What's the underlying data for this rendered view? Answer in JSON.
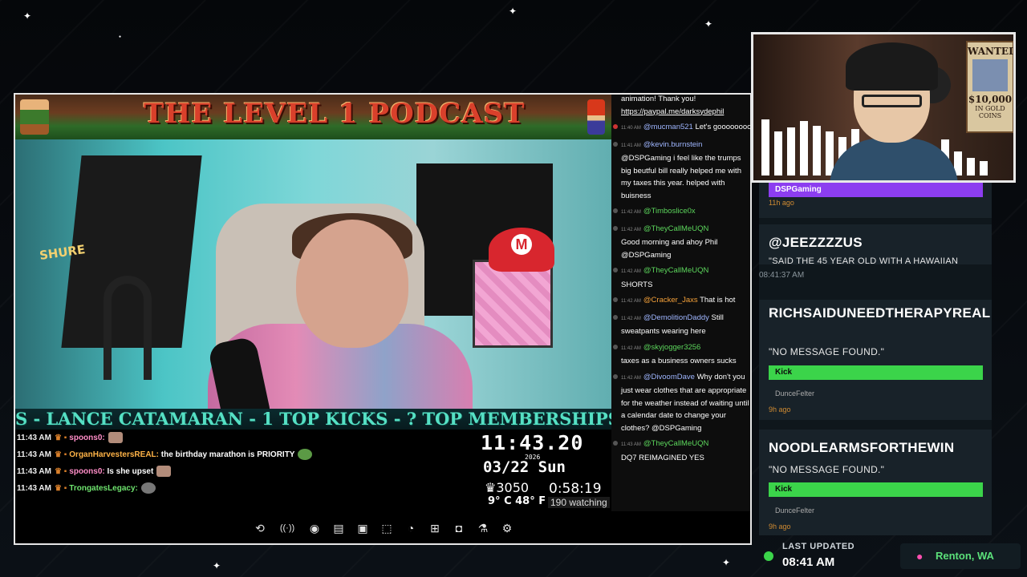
{
  "overlay": {
    "banner_title": "THE LEVEL 1 PODCAST",
    "ticker_text": "S - LANCE CATAMARAN - 1     TOP KICKS - ?     TOP MEMBERSHIPS - ",
    "clock": {
      "time": "11:43.20",
      "year": "2026",
      "date": "03/22 Sun",
      "subs": "3050",
      "uptime": "0:58:19",
      "temp": "9° C 48° F",
      "watching": "190 watching"
    },
    "chat": [
      {
        "time": "11:43 AM",
        "name": "spoons0:",
        "name_color": "pink",
        "text": ""
      },
      {
        "time": "11:43 AM",
        "name": "OrganHarvestersREAL:",
        "name_color": "orange",
        "text": "the birthday marathon is PRIORITY"
      },
      {
        "time": "11:43 AM",
        "name": "spoons0:",
        "name_color": "pink",
        "text": "Is she upset"
      },
      {
        "time": "11:43 AM",
        "name": "TrongatesLegacy:",
        "name_color": "green",
        "text": ""
      }
    ]
  },
  "stream_chat": [
    {
      "user": "",
      "user_color": "blue",
      "text": "animation! Thank you!",
      "link": "https://paypal.me/darksydephil"
    },
    {
      "meta": "11:40 AM",
      "user": "@mucman521",
      "user_color": "blue",
      "text": "Let's goooooooo"
    },
    {
      "meta": "11:41 AM",
      "user": "@kevin.burnstein",
      "user_color": "blue",
      "text": "@DSPGaming i feel like the trumps big beutful bill really helped me with my taxes this year. helped with buisness"
    },
    {
      "meta": "11:42 AM",
      "user": "@Timboslice0x",
      "user_color": "green",
      "text": ""
    },
    {
      "meta": "11:42 AM",
      "user": "@TheyCallMeUQN",
      "user_color": "green",
      "text": "Good morning and ahoy Phil @DSPGaming"
    },
    {
      "meta": "11:42 AM",
      "user": "@TheyCallMeUQN",
      "user_color": "green",
      "text": "SHORTS"
    },
    {
      "meta": "11:42 AM",
      "user": "@Cracker_Jaxs",
      "user_color": "green",
      "text": "That is hot"
    },
    {
      "meta": "11:42 AM",
      "user": "@DemolitionDaddy",
      "user_color": "blue",
      "text": "Still sweatpants wearing here"
    },
    {
      "meta": "11:42 AM",
      "user": "@skyjogger3256",
      "user_color": "green",
      "text": "taxes as a business owners sucks"
    },
    {
      "meta": "11:42 AM",
      "user": "@DivoomDave",
      "user_color": "blue",
      "text": "Why don't you just wear clothes that are appropriate for the weather instead of waiting until a calendar date to change your clothes? @DSPGaming"
    },
    {
      "meta": "11:43 AM",
      "user": "@TheyCallMeUQN",
      "user_color": "green",
      "text": "DQ7 REIMAGINED YES"
    }
  ],
  "controls": [
    {
      "name": "loop-icon",
      "glyph": "⟲"
    },
    {
      "name": "broadcast-icon",
      "glyph": "((·))"
    },
    {
      "name": "view-icon",
      "glyph": "◉"
    },
    {
      "name": "clapper-icon",
      "glyph": "▤"
    },
    {
      "name": "pip-icon",
      "glyph": "▣"
    },
    {
      "name": "crop-icon",
      "glyph": "⬚"
    },
    {
      "name": "speed-icon",
      "glyph": "◔"
    },
    {
      "name": "add-frame-icon",
      "glyph": "⊞"
    },
    {
      "name": "camera-icon",
      "glyph": "◘"
    },
    {
      "name": "flask-icon",
      "glyph": "⚗"
    },
    {
      "name": "gear-icon",
      "glyph": "⚙"
    }
  ],
  "alerts": {
    "top_label": "DSPGaming",
    "top_ago": "11h ago",
    "card1": {
      "title": "@JEEZZZZUS",
      "msg": "\"SAID THE 45 YEAR OLD WITH A HAWAIIAN",
      "timestamp": "08:41:37 AM"
    },
    "card2": {
      "title": "RICHSAIDUNEEDTHERAPYREAL",
      "msg": "\"NO MESSAGE FOUND.\"",
      "label": "Kick",
      "user": "DunceFelter",
      "ago": "9h ago"
    },
    "card3": {
      "title": "NOODLEARMSFORTHEWIN",
      "msg": "\"NO MESSAGE FOUND.\"",
      "label": "Kick",
      "user": "DunceFelter",
      "ago": "9h ago"
    },
    "colors": {
      "kick": "#3bd44a",
      "purple": "#8c3df0"
    }
  },
  "footer": {
    "last_updated_label": "LAST UPDATED",
    "last_updated_time": "08:41 AM",
    "location": "Renton, WA"
  },
  "facecam": {
    "wanted_title": "WANTED",
    "wanted_amount": "$10,000",
    "wanted_sub": "IN GOLD COINS"
  }
}
